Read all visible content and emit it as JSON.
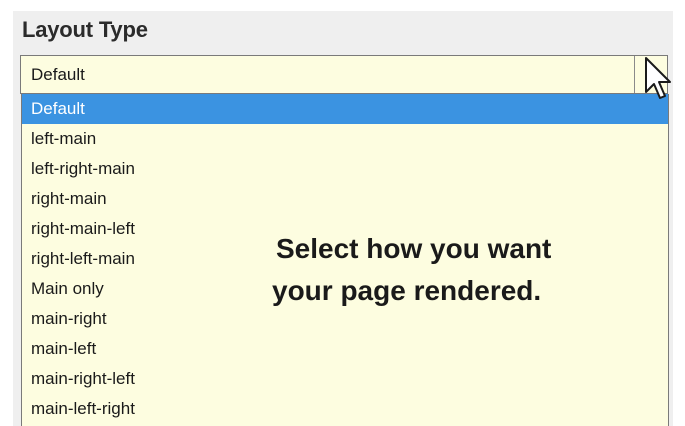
{
  "label": "Layout Type",
  "select": {
    "value": "Default"
  },
  "options": [
    "Default",
    "left-main",
    "left-right-main",
    "right-main",
    "right-main-left",
    "right-left-main",
    "Main only",
    "main-right",
    "main-left",
    "main-right-left",
    "main-left-right"
  ],
  "selected_option": "Default",
  "hint": {
    "line1": "Select how you want",
    "line2": "your page rendered."
  },
  "colors": {
    "field_background": "#fdfde0",
    "highlight": "#3b93e1",
    "panel": "#efefef"
  },
  "icons": {
    "cursor": "mouse-pointer-icon"
  }
}
